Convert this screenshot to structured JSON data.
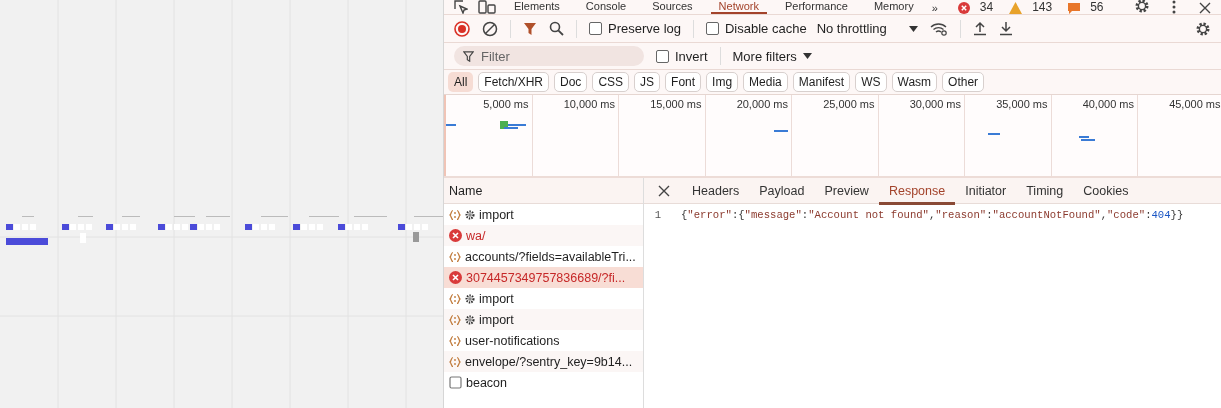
{
  "panel_tabs": [
    {
      "label": "Elements",
      "selected": false
    },
    {
      "label": "Console",
      "selected": false
    },
    {
      "label": "Sources",
      "selected": false
    },
    {
      "label": "Network",
      "selected": true
    },
    {
      "label": "Performance",
      "selected": false
    },
    {
      "label": "Memory",
      "selected": false
    }
  ],
  "more_tabs": "»",
  "issue_counts": [
    {
      "kind": "error",
      "count": "34"
    },
    {
      "kind": "warning",
      "count": "143"
    },
    {
      "kind": "info",
      "count": "56"
    }
  ],
  "toolbar": {
    "recording": true,
    "preserve_log": {
      "label": "Preserve log",
      "checked": false
    },
    "disable_cache": {
      "label": "Disable cache",
      "checked": false
    },
    "throttling": "No throttling"
  },
  "filter": {
    "placeholder": "Filter",
    "invert": {
      "label": "Invert",
      "checked": false
    },
    "more_filters": "More filters"
  },
  "type_filters": [
    {
      "label": "All",
      "selected": true
    },
    {
      "label": "Fetch/XHR",
      "selected": false
    },
    {
      "label": "Doc",
      "selected": false
    },
    {
      "label": "CSS",
      "selected": false
    },
    {
      "label": "JS",
      "selected": false
    },
    {
      "label": "Font",
      "selected": false
    },
    {
      "label": "Img",
      "selected": false
    },
    {
      "label": "Media",
      "selected": false
    },
    {
      "label": "Manifest",
      "selected": false
    },
    {
      "label": "WS",
      "selected": false
    },
    {
      "label": "Wasm",
      "selected": false
    },
    {
      "label": "Other",
      "selected": false
    }
  ],
  "overview": {
    "ticks": [
      "5,000 ms",
      "10,000 ms",
      "15,000 ms",
      "20,000 ms",
      "25,000 ms",
      "30,000 ms",
      "35,000 ms",
      "40,000 ms",
      "45,000 ms"
    ]
  },
  "requests": {
    "column": "Name",
    "rows": [
      {
        "name": "import",
        "kind": "fetch",
        "gear": true,
        "selected": false
      },
      {
        "name": "wa/",
        "kind": "error",
        "gear": false,
        "selected": false
      },
      {
        "name": "accounts/?fields=availableTri...",
        "kind": "fetch",
        "gear": false,
        "selected": false
      },
      {
        "name": "3074457349757836689/?fi...",
        "kind": "error",
        "gear": false,
        "selected": true
      },
      {
        "name": "import",
        "kind": "fetch",
        "gear": true,
        "selected": false
      },
      {
        "name": "import",
        "kind": "fetch",
        "gear": true,
        "selected": false
      },
      {
        "name": "user-notifications",
        "kind": "fetch",
        "gear": false,
        "selected": false
      },
      {
        "name": "envelope/?sentry_key=9b14...",
        "kind": "fetch",
        "gear": false,
        "selected": false
      },
      {
        "name": "beacon",
        "kind": "other",
        "gear": false,
        "selected": false
      }
    ]
  },
  "detail": {
    "tabs": [
      {
        "label": "Headers",
        "selected": false
      },
      {
        "label": "Payload",
        "selected": false
      },
      {
        "label": "Preview",
        "selected": false
      },
      {
        "label": "Response",
        "selected": true
      },
      {
        "label": "Initiator",
        "selected": false
      },
      {
        "label": "Timing",
        "selected": false
      },
      {
        "label": "Cookies",
        "selected": false
      }
    ],
    "lines": [
      {
        "number": "1",
        "text": "{\"error\":{\"message\":\"Account not found\",\"reason\":\"accountNotFound\",\"code\":404}}"
      }
    ]
  }
}
